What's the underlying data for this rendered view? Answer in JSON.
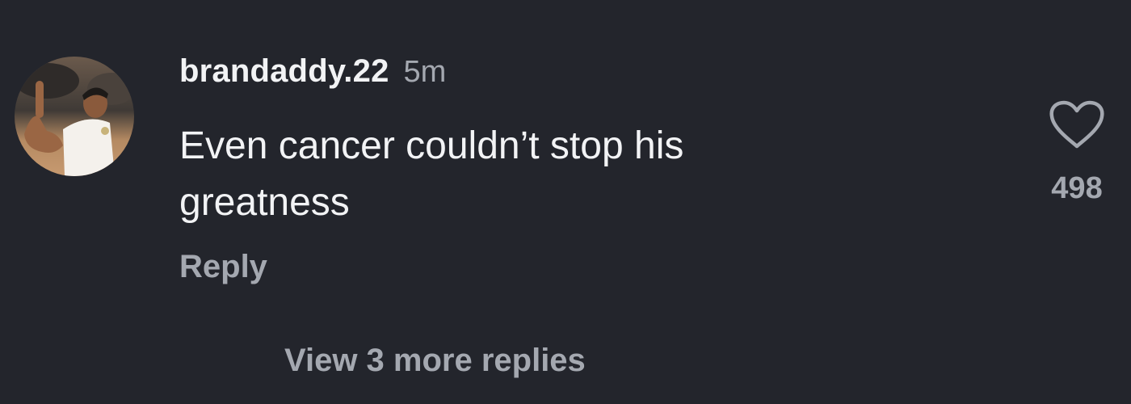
{
  "comment": {
    "username": "brandaddy.22",
    "time_ago": "5m",
    "text_lines": [
      "Even cancer couldn’t stop his",
      "greatness"
    ],
    "reply_label": "Reply",
    "view_replies_label": "View 3 more replies",
    "like_icon": "heart-outline-icon",
    "like_count": "498"
  },
  "colors": {
    "background": "#23252c",
    "primary_text": "#f2f3f5",
    "secondary_text": "#a4a8b0"
  }
}
